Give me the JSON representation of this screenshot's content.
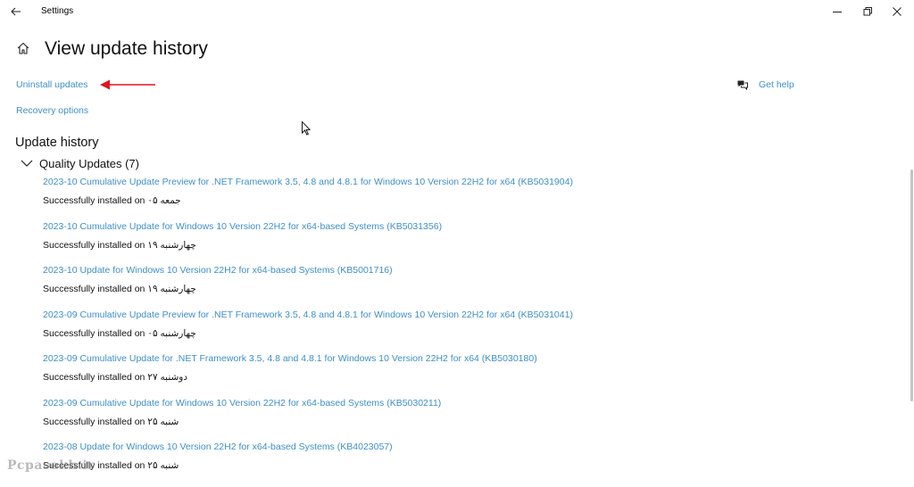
{
  "window": {
    "app_title": "Settings",
    "controls": [
      "minimize-icon",
      "restore-icon",
      "close-icon"
    ]
  },
  "header": {
    "title": "View update history",
    "icon": "home-icon"
  },
  "links": {
    "uninstall": "Uninstall updates",
    "recovery": "Recovery options",
    "help": "Get help",
    "help_icon": "chat-help-icon"
  },
  "annotation": {
    "arrow_color": "#e0141e"
  },
  "accent_color": "#3f8fc6",
  "history": {
    "title": "Update history",
    "group": {
      "title": "Quality Updates (7)",
      "expanded": true,
      "items": [
        {
          "name": "2023-10 Cumulative Update Preview for .NET Framework 3.5, 4.8 and 4.8.1 for Windows 10 Version 22H2 for x64 (KB5031904)",
          "status": "Successfully installed on ۰۵ جمعه"
        },
        {
          "name": "2023-10 Cumulative Update for Windows 10 Version 22H2 for x64-based Systems (KB5031356)",
          "status": "Successfully installed on ۱۹ چهارشنبه"
        },
        {
          "name": "2023-10 Update for Windows 10 Version 22H2 for x64-based Systems (KB5001716)",
          "status": "Successfully installed on ۱۹ چهارشنبه"
        },
        {
          "name": "2023-09 Cumulative Update Preview for .NET Framework 3.5, 4.8 and 4.8.1 for Windows 10 Version 22H2 for x64 (KB5031041)",
          "status": "Successfully installed on ۰۵ چهارشنبه"
        },
        {
          "name": "2023-09 Cumulative Update for .NET Framework 3.5, 4.8 and 4.8.1 for Windows 10 Version 22H2 for x64 (KB5030180)",
          "status": "Successfully installed on ۲۷ دوشنبه"
        },
        {
          "name": "2023-09 Cumulative Update for Windows 10 Version 22H2 for x64-based Systems (KB5030211)",
          "status": "Successfully installed on ۲۵ شنبه"
        },
        {
          "name": "2023-08 Update for Windows 10 Version 22H2 for x64-based Systems (KB4023057)",
          "status": "Successfully installed on ۲۵ شنبه"
        }
      ]
    }
  },
  "watermark": "Pcpasokh.ir"
}
